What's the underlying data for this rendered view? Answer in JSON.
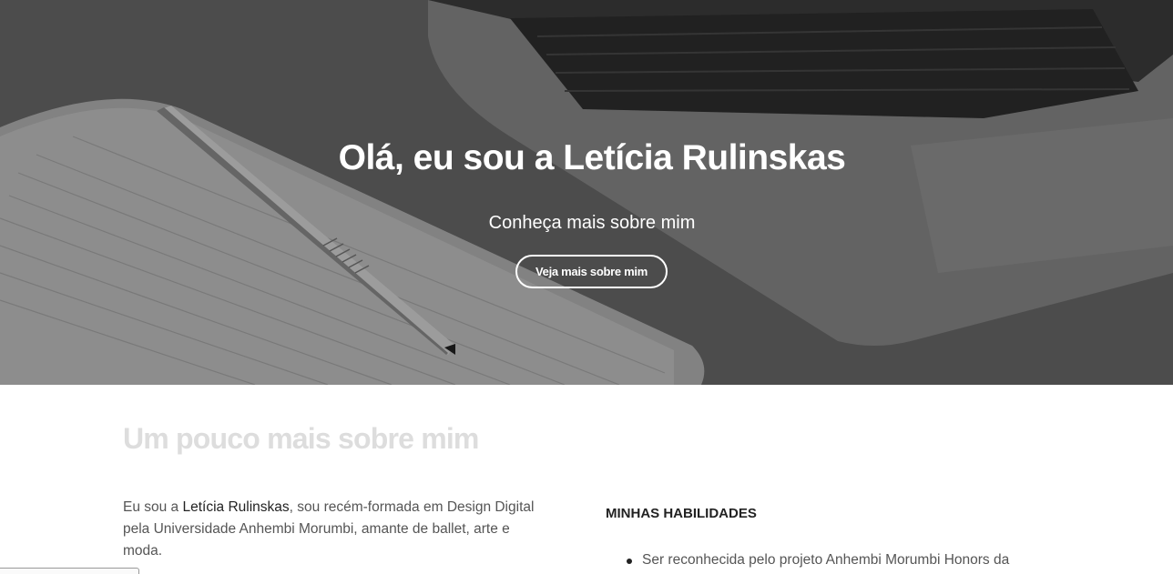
{
  "hero": {
    "title": "Olá, eu sou a Letícia Rulinskas",
    "subtitle": "Conheça mais sobre mim",
    "button_label": "Veja mais sobre mim"
  },
  "about": {
    "heading": "Um pouco mais sobre mim",
    "intro_prefix": "Eu sou a ",
    "intro_name": "Letícia Rulinskas",
    "intro_line1_rest": ", sou recém-formada em Design Digital",
    "intro_line2": "pela Universidade Anhembi Morumbi, amante de ballet, arte e",
    "intro_line3": "moda."
  },
  "skills": {
    "title": "MINHAS HABILIDADES",
    "items": [
      "Ser reconhecida pelo projeto Anhembi Morumbi Honors da"
    ]
  },
  "colors": {
    "heading_muted": "#dddddd",
    "body_text": "#555555",
    "hero_text": "#ffffff"
  }
}
